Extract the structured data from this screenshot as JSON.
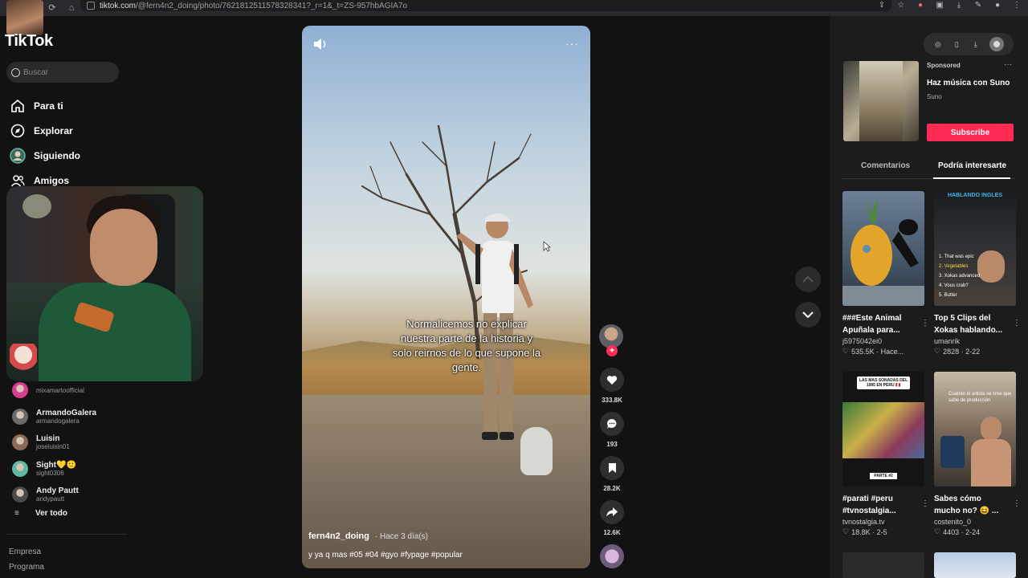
{
  "browser": {
    "url_host": "tiktok.com",
    "url_path": "/@fern4n2_doing/photo/7621812511578328341?_r=1&_t=ZS-957hbAGIA7o"
  },
  "app": {
    "logo": "TikTok"
  },
  "search": {
    "placeholder": "Buscar"
  },
  "nav": [
    {
      "label": "Para ti",
      "icon": "home-icon"
    },
    {
      "label": "Explorar",
      "icon": "compass-icon"
    },
    {
      "label": "Siguiendo",
      "icon": "following-avatar-icon"
    },
    {
      "label": "Amigos",
      "icon": "friends-icon"
    }
  ],
  "following": [
    {
      "name": "",
      "handle": "mixamartoofficial",
      "color": "#d63f91"
    },
    {
      "name": "ArmandoGalera",
      "handle": "armandogalera",
      "color": "#6b6b6b"
    },
    {
      "name": "Luisin",
      "handle": "joseluisin01",
      "color": "#8b6a55"
    },
    {
      "name": "Sight💛🙂",
      "handle": "sight0306",
      "color": "#5fb8a6"
    },
    {
      "name": "Andy Pautt",
      "handle": "andypautt",
      "color": "#4a4a4a"
    }
  ],
  "see_all": "Ver todo",
  "footer": [
    "Empresa",
    "Programa"
  ],
  "video": {
    "caption": "Normalicemos no explicar nuestra parte de la historia y solo reirnos de lo que supone la gente.",
    "author": "fern4n2_doing",
    "time": "· Hace 3 día(s)",
    "description": "y ya q mas #05 #04 #gyo #fypage #popular"
  },
  "actions": {
    "likes": "333.8K",
    "comments": "193",
    "saves": "28.2K",
    "shares": "12.6K"
  },
  "ad": {
    "sponsored": "Sponsored",
    "title": "Haz música con Suno",
    "advertiser": "Suno",
    "cta": "Subscribe"
  },
  "tabs": {
    "comments": "Comentarios",
    "recommended": "Podría interesarte"
  },
  "recommended": [
    {
      "title": "###Este Animal Apuñala para...",
      "author": "j5975042ei0",
      "stats": "535.5K · Hace..."
    },
    {
      "title": "Top 5 Clips del Xokas hablando...",
      "author": "umanrik",
      "stats": "2828 · 2-22"
    },
    {
      "title": "#parati #peru #tvnostalgia...",
      "author": "tvnostalgia.tv",
      "stats": "18.8K · 2-5"
    },
    {
      "title": "Sabes cómo mucho no? 😆 ...",
      "author": "costenito_0",
      "stats": "4403 · 2-24"
    }
  ],
  "thumb_texts": {
    "r2_banner": "HABLANDO INGLES",
    "r2_list": [
      "1. That was epic",
      "2. Vegetables",
      "3. Xokas advanced",
      "4. Vous crab?",
      "5. Butter"
    ],
    "r3_banner": "LAS MAS SONADAS DEL 1995 EN PERU 🇵🇪",
    "r3_footer": "PARTE #2",
    "r4_top": "Cuando el artista se cree que sabe de producción"
  },
  "colors": {
    "accent": "#fe2c55",
    "bg": "#121212",
    "panel": "#1c1c1c"
  }
}
